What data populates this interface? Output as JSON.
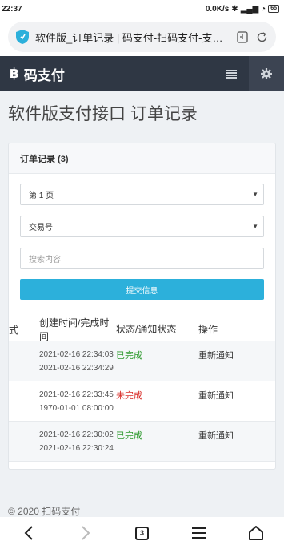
{
  "status": {
    "time": "22:37",
    "speed": "0.0K/s",
    "battery": "65"
  },
  "browser": {
    "url_text": "软件版_订单记录 | 码支付-扫码支付-支付宝"
  },
  "app": {
    "brand": "码支付",
    "brand_icon": "฿"
  },
  "page": {
    "title": "软件版支付接口 订单记录"
  },
  "card": {
    "header": "订单记录 (3)",
    "page_select": "第 1 页",
    "field_select": "交易号",
    "search_placeholder": "搜索内容",
    "submit_label": "提交信息"
  },
  "table": {
    "cut_header": "式",
    "headers": [
      "创建时间/完成时间",
      "状态/通知状态",
      "操作"
    ],
    "rows": [
      {
        "created": "2021-02-16 22:34:03",
        "finished": "2021-02-16 22:34:29",
        "status": "已完成",
        "action": "重新通知"
      },
      {
        "created": "2021-02-16 22:33:45",
        "finished": "1970-01-01 08:00:00",
        "status": "未完成",
        "action": "重新通知"
      },
      {
        "created": "2021-02-16 22:30:02",
        "finished": "2021-02-16 22:30:24",
        "status": "已完成",
        "action": "重新通知"
      }
    ]
  },
  "footer": {
    "text": "© 2020 扫码支付"
  },
  "nav": {
    "tab_count": "3"
  },
  "colors": {
    "header_bg": "#2f3744",
    "accent": "#2cb0db",
    "success": "#2f9a2f",
    "danger": "#d9302b"
  }
}
